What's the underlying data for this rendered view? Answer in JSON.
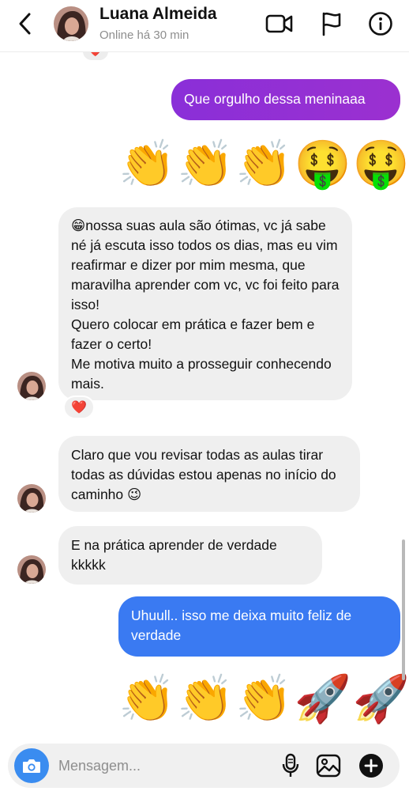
{
  "header": {
    "back_icon": "chevron-left-icon",
    "name": "Luana Almeida",
    "status": "Online há 30 min",
    "icons": [
      "video-call-icon",
      "flag-icon",
      "info-icon"
    ]
  },
  "messages": [
    {
      "from": "contact",
      "kind": "reaction",
      "reaction": "❤️"
    },
    {
      "from": "me",
      "kind": "text",
      "text": "Que orgulho dessa meninaaa"
    },
    {
      "from": "me",
      "kind": "emoji",
      "text": "👏👏👏🤑🤑"
    },
    {
      "from": "contact",
      "kind": "text",
      "lines": [
        "😁nossa suas aula são ótimas, vc já sabe né já escuta isso todos os dias, mas eu vim reafirmar e dizer por mim mesma, que maravilha aprender com vc, vc foi feito para isso!",
        "Quero colocar em prática e fazer bem e fazer o certo!",
        "Me motiva muito a prosseguir conhecendo mais."
      ],
      "reaction": "❤️"
    },
    {
      "from": "contact",
      "kind": "text",
      "text": "Claro que vou revisar todas as aulas tirar todas as dúvidas estou apenas no início do caminho 😉"
    },
    {
      "from": "contact",
      "kind": "text",
      "text": "E na prática aprender de verdade kkkkk"
    },
    {
      "from": "me",
      "kind": "text",
      "text": "Uhuull.. isso me deixa muito feliz de verdade"
    },
    {
      "from": "me",
      "kind": "emoji",
      "text": "👏👏👏🚀🚀"
    }
  ],
  "composer": {
    "placeholder": "Mensagem...",
    "camera_icon": "camera-icon",
    "icons": [
      "microphone-icon",
      "image-icon",
      "plus-icon"
    ]
  },
  "colors": {
    "outgoing_purple": "#8a2fd8",
    "outgoing_blue": "#3a7af2",
    "incoming_bg": "#efefef",
    "camera_button": "#3a8cf0",
    "status_gray": "#8e8e8e"
  }
}
